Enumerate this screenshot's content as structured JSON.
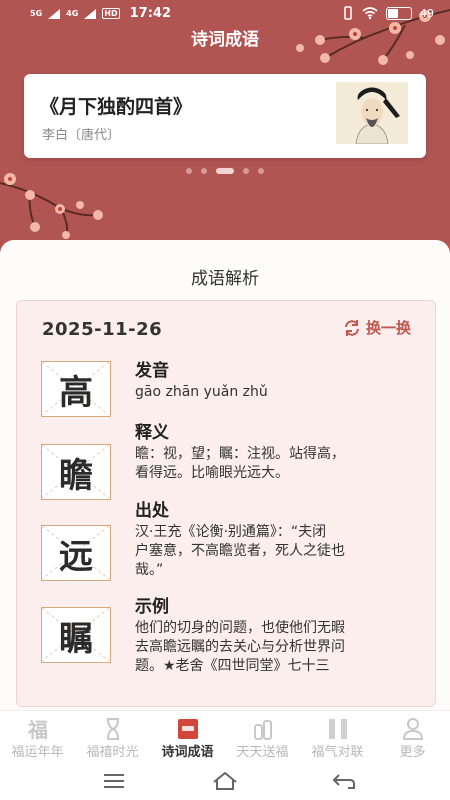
{
  "status_bar": {
    "sig1": "5G",
    "sig2": "4G",
    "hd": "HD",
    "time": "17:42",
    "battery": "49",
    "battery_level": 0.49
  },
  "header": {
    "title": "诗词成语"
  },
  "poem": {
    "title": "《月下独酌四首》",
    "author": "李白〔唐代〕"
  },
  "carousel": {
    "count": 5,
    "active": 2
  },
  "section": {
    "title": "成语解析"
  },
  "idiom": {
    "date": "2025-11-26",
    "refresh_label": "换一换",
    "chars": [
      "高",
      "瞻",
      "远",
      "瞩"
    ],
    "pronunciation_label": "发音",
    "pronunciation": "gāo zhān yuǎn zhǔ",
    "meaning_label": "释义",
    "meaning_lines": [
      "瞻：视，望；瞩：注视。站得高，",
      "看得远。比喻眼光远大。"
    ],
    "source_label": "出处",
    "source_lines": [
      "汉·王充《论衡·别通篇》：“夫闭",
      "户塞意，不高瞻览者，死人之徒也",
      "哉。”"
    ],
    "example_label": "示例",
    "example_lines": [
      "他们的切身的问题，也使他们无暇",
      "去高瞻远瞩的去关心与分析世界问",
      "题。★老舍《四世同堂》七十三"
    ]
  },
  "nav": {
    "items": [
      {
        "label": "福运年年",
        "icon": "fu-icon"
      },
      {
        "label": "福禧时光",
        "icon": "hourglass-icon"
      },
      {
        "label": "诗词成语",
        "icon": "poetry-book-icon",
        "active": true
      },
      {
        "label": "天天送福",
        "icon": "gift-bottles-icon"
      },
      {
        "label": "福气对联",
        "icon": "couplet-icon"
      },
      {
        "label": "更多",
        "icon": "person-icon"
      }
    ]
  },
  "colors": {
    "header_bg": "#b15552",
    "accent": "#c0584f",
    "card_bg": "#fbeeec",
    "grid_border": "#d9a77f"
  }
}
